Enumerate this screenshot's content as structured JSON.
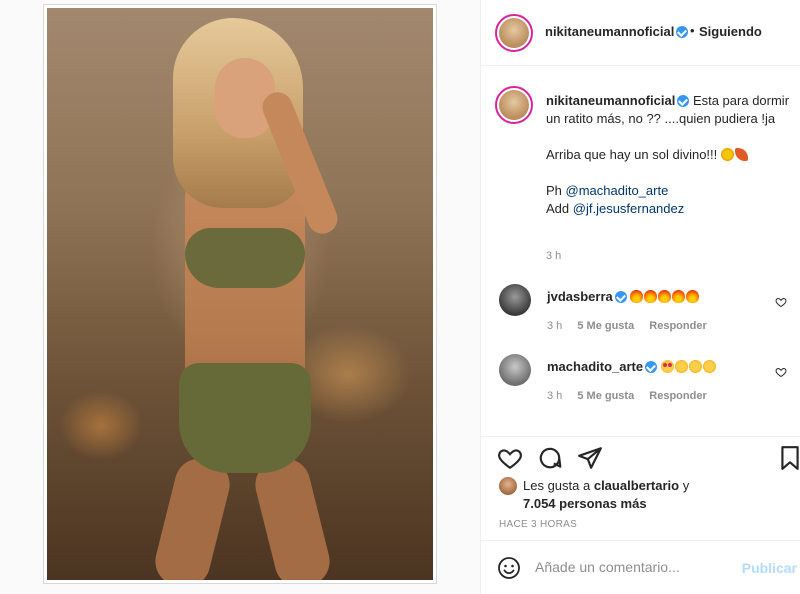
{
  "header": {
    "username": "nikitaneumannoficial",
    "separator": "•",
    "follow_status": "Siguiendo"
  },
  "caption": {
    "username": "nikitaneumannoficial",
    "line1": "Esta para dormir un ratito más, no ?? ....quien pudiera !ja",
    "line2": "Arriba que hay un sol divino!!!",
    "ph_label": "Ph",
    "ph_handle": "@machadito_arte",
    "add_label": "Add",
    "add_handle": "@jf.jesusfernandez",
    "time": "3 h"
  },
  "comments": [
    {
      "username": "jvdasberra",
      "emoji": "fire",
      "emoji_count": 5,
      "time": "3 h",
      "likes": "5 Me gusta",
      "reply": "Responder"
    },
    {
      "username": "machadito_arte",
      "emoji_sequence": [
        "heart-eyes",
        "clap",
        "clap",
        "clap"
      ],
      "time": "3 h",
      "likes": "5 Me gusta",
      "reply": "Responder"
    }
  ],
  "likes": {
    "prefix": "Les gusta a",
    "user": "claualbertario",
    "connector": "y",
    "others": "7.054 personas más"
  },
  "time_ago": "HACE 3 HORAS",
  "add_comment": {
    "placeholder": "Añade un comentario...",
    "publish": "Publicar"
  },
  "icons": {
    "like": "heart-icon",
    "comment": "comment-icon",
    "share": "share-icon",
    "save": "bookmark-icon",
    "emoji": "emoji-icon"
  },
  "colors": {
    "verified": "#3897f0",
    "link": "#00376b",
    "publish_disabled": "#b3dbff",
    "muted": "#8e8e8e"
  }
}
